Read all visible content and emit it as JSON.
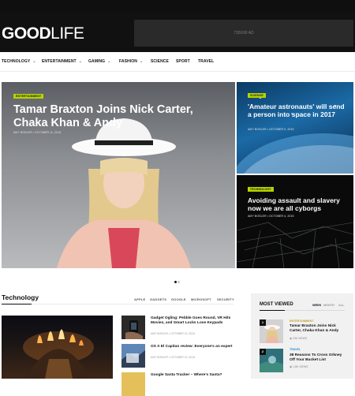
{
  "site": {
    "logo_bold": "GOOD",
    "logo_light": "LIFE",
    "ad_label": "728X90 AD"
  },
  "nav": {
    "items": [
      {
        "label": "TECHNOLOGY",
        "has_dropdown": true
      },
      {
        "label": "ENTERTAINMENT",
        "has_dropdown": true
      },
      {
        "label": "GAMING",
        "has_dropdown": true
      },
      {
        "label": "FASHION",
        "has_dropdown": true
      },
      {
        "label": "SCIENCE",
        "has_dropdown": false
      },
      {
        "label": "SPORT",
        "has_dropdown": false
      },
      {
        "label": "TRAVEL",
        "has_dropdown": false
      }
    ]
  },
  "hero": {
    "category": "ENTERTAINMENT",
    "title": "Tamar Braxton Joins Nick Carter, Chaka Khan & Andy",
    "meta": "AMY BOSLER  •  OCTOBER 11, 2015"
  },
  "side_posts": [
    {
      "category": "SCIENCE",
      "title": "'Amateur astronauts' will send a person into space in 2017",
      "meta": "AMY BOSLER  •  OCTOBER 9, 2015"
    },
    {
      "category": "TECHNOLOGY",
      "title": "Avoiding assault and slavery now we are all cyborgs",
      "meta": "AMY BOSLER  •  OCTOBER 4, 2015"
    }
  ],
  "slider": {
    "total_dots": 2,
    "active_index": 0
  },
  "technology_section": {
    "title": "Technology",
    "filters": [
      "APPLE",
      "GADGETS",
      "GOOGLE",
      "MICROSOFT",
      "SECURITY"
    ],
    "posts": [
      {
        "title": "Gadget Ogling: Pebble Goes Round, VR Hits Movies, and Smart Locks Lose Keypads",
        "meta": "AMY BOSLER  •  OCTOBER 13, 2015"
      },
      {
        "title": "OS X El Capitan review: Everyone's an expert",
        "meta": "AMY BOSLER  •  OCTOBER 13, 2015"
      },
      {
        "title": "Google Santa Tracker – Where's Santa?",
        "meta": ""
      }
    ]
  },
  "most_viewed": {
    "title": "MOST VIEWED",
    "filters": [
      "WEEK",
      "MONTH",
      "ALL"
    ],
    "active_filter": "WEEK",
    "items": [
      {
        "rank": "1",
        "category": "ENTERTAINMENT",
        "category_color": "#c39b2f",
        "title": "Tamar Braxton Joins Nick Carter, Chaka Khan & Andy",
        "views": "236 VIEWS"
      },
      {
        "rank": "2",
        "category": "TRAVEL",
        "category_color": "#1f8fd6",
        "title": "38 Reasons To Cross Orkney Off Your Bucket List",
        "views": "1.8K VIEWS"
      }
    ]
  },
  "colors": {
    "accent_tag": "#b7d300",
    "header_bg": "#111111"
  }
}
